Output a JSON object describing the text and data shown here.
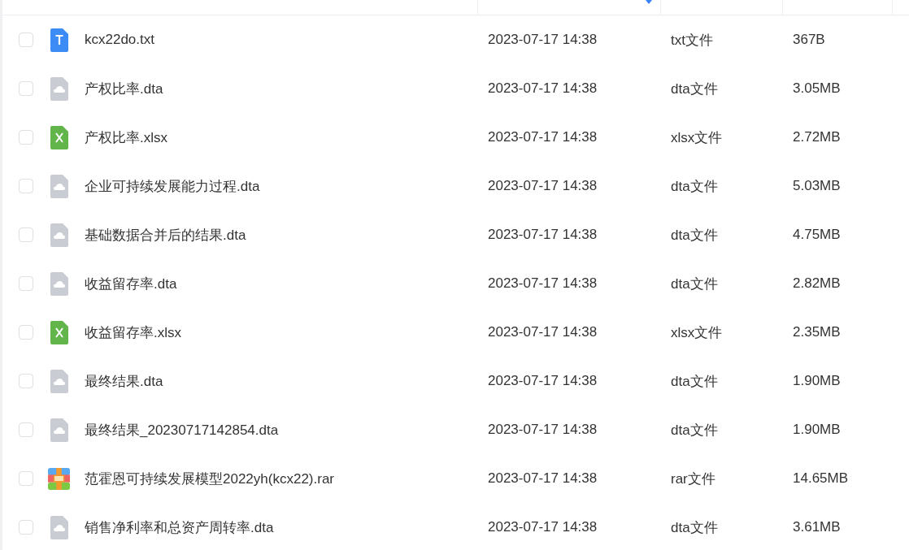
{
  "table": {
    "columns": [
      {
        "sorted": false
      },
      {
        "sorted": true
      },
      {
        "sorted": false
      },
      {
        "sorted": false
      }
    ],
    "rows": [
      {
        "kind": "txt",
        "checked": false,
        "name": "kcx22do.txt",
        "modified": "2023-07-17 14:38",
        "type": "txt文件",
        "size": "367B"
      },
      {
        "kind": "dta",
        "checked": false,
        "name": "产权比率.dta",
        "modified": "2023-07-17 14:38",
        "type": "dta文件",
        "size": "3.05MB"
      },
      {
        "kind": "xlsx",
        "checked": false,
        "name": "产权比率.xlsx",
        "modified": "2023-07-17 14:38",
        "type": "xlsx文件",
        "size": "2.72MB"
      },
      {
        "kind": "dta",
        "checked": false,
        "name": "企业可持续发展能力过程.dta",
        "modified": "2023-07-17 14:38",
        "type": "dta文件",
        "size": "5.03MB"
      },
      {
        "kind": "dta",
        "checked": false,
        "name": "基础数据合并后的结果.dta",
        "modified": "2023-07-17 14:38",
        "type": "dta文件",
        "size": "4.75MB"
      },
      {
        "kind": "dta",
        "checked": false,
        "name": "收益留存率.dta",
        "modified": "2023-07-17 14:38",
        "type": "dta文件",
        "size": "2.82MB"
      },
      {
        "kind": "xlsx",
        "checked": false,
        "name": "收益留存率.xlsx",
        "modified": "2023-07-17 14:38",
        "type": "xlsx文件",
        "size": "2.35MB"
      },
      {
        "kind": "dta",
        "checked": false,
        "name": "最终结果.dta",
        "modified": "2023-07-17 14:38",
        "type": "dta文件",
        "size": "1.90MB"
      },
      {
        "kind": "dta",
        "checked": false,
        "name": "最终结果_20230717142854.dta",
        "modified": "2023-07-17 14:38",
        "type": "dta文件",
        "size": "1.90MB"
      },
      {
        "kind": "rar",
        "checked": false,
        "name": "范霍恩可持续发展模型2022yh(kcx22).rar",
        "modified": "2023-07-17 14:38",
        "type": "rar文件",
        "size": "14.65MB"
      },
      {
        "kind": "dta",
        "checked": false,
        "name": "销售净利率和总资产周转率.dta",
        "modified": "2023-07-17 14:38",
        "type": "dta文件",
        "size": "3.61MB"
      }
    ]
  }
}
